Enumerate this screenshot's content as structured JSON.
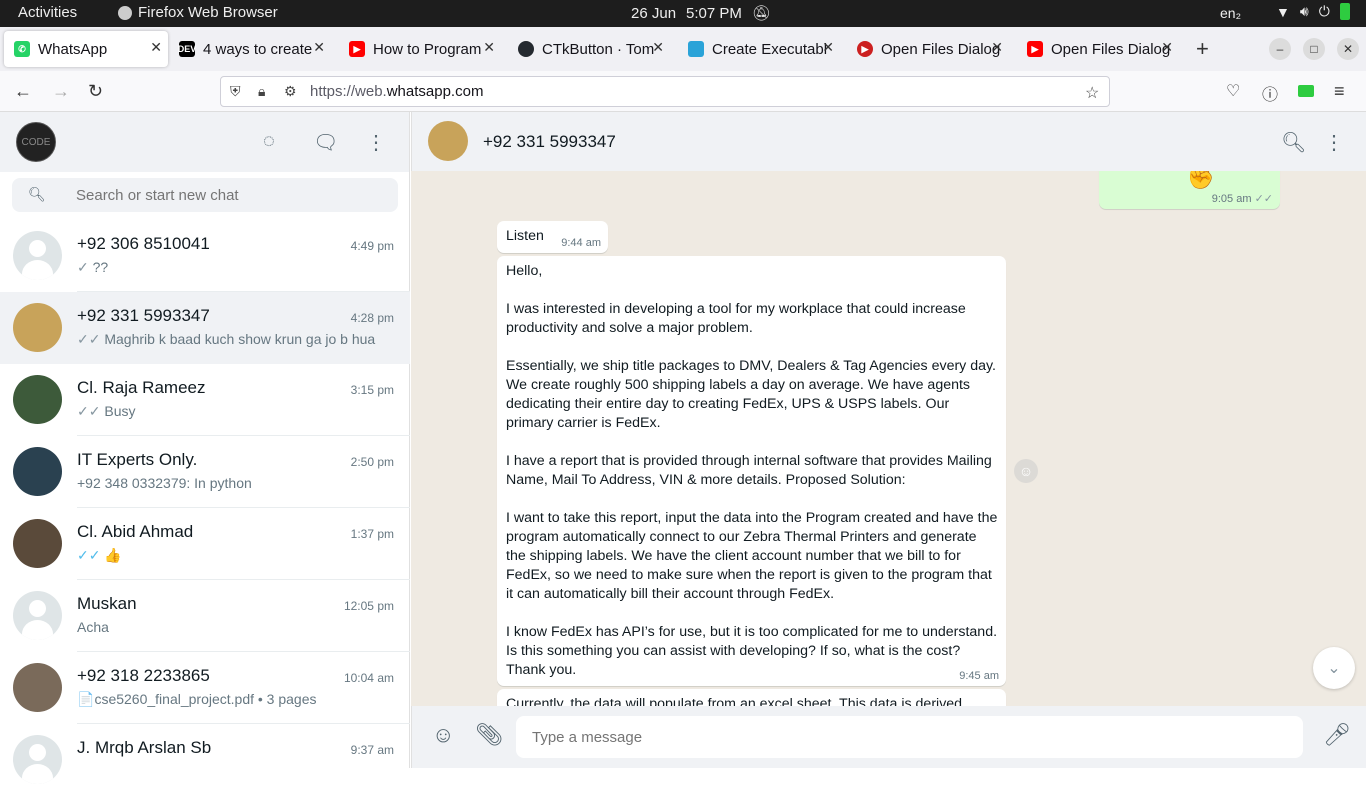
{
  "topbar": {
    "activities": "Activities",
    "app_name": "Firefox Web Browser",
    "date": "26 Jun",
    "time": "5:07 PM",
    "lang": "en₂"
  },
  "browser": {
    "tabs": [
      {
        "title": "WhatsApp",
        "fav": "#25d366",
        "icon": "whatsapp-icon"
      },
      {
        "title": "4 ways to create",
        "fav": "#000000",
        "icon": "dev-icon"
      },
      {
        "title": "How to Program",
        "fav": "#ff0000",
        "icon": "youtube-icon"
      },
      {
        "title": "CTkButton · Tom",
        "fav": "#24292f",
        "icon": "github-icon"
      },
      {
        "title": "Create Executabl",
        "fav": "#2aa3d8",
        "icon": "site-icon"
      },
      {
        "title": "Open Files Dialog",
        "fav": "#cc2020",
        "icon": "site-icon"
      },
      {
        "title": "Open Files Dialog",
        "fav": "#ff0000",
        "icon": "youtube-icon"
      }
    ],
    "url_prefix": "https://web.",
    "url_domain": "whatsapp.com"
  },
  "sidebar": {
    "my_avatar_text": "CODE",
    "search_placeholder": "Search or start new chat",
    "chats": [
      {
        "name": "+92 306 8510041",
        "time": "4:49 pm",
        "tick": "✓",
        "tick_color": "grey",
        "preview": "??",
        "avatar_color": "#dfe5e7",
        "default_avatar": true
      },
      {
        "name": "+92 331 5993347",
        "time": "4:28 pm",
        "tick": "✓✓",
        "tick_color": "grey",
        "preview": "Maghrib k baad kuch show krun ga jo b hua",
        "avatar_color": "#c8a35a",
        "default_avatar": false,
        "selected": true
      },
      {
        "name": "Cl. Raja Rameez",
        "time": "3:15 pm",
        "tick": "✓✓",
        "tick_color": "grey",
        "preview": "Busy",
        "avatar_color": "#3d5a3a",
        "default_avatar": false
      },
      {
        "name": "IT Experts Only.",
        "time": "2:50 pm",
        "tick": "",
        "tick_color": "grey",
        "preview": "+92 348 0332379: In python",
        "avatar_color": "#2a4150",
        "default_avatar": false
      },
      {
        "name": "Cl. Abid Ahmad",
        "time": "1:37 pm",
        "tick": "✓✓",
        "tick_color": "blue",
        "preview": "👍",
        "avatar_color": "#5a4a3a",
        "default_avatar": false
      },
      {
        "name": "Muskan",
        "time": "12:05 pm",
        "tick": "",
        "tick_color": "grey",
        "preview": "Acha",
        "avatar_color": "#dfe5e7",
        "default_avatar": true
      },
      {
        "name": "+92 318 2233865",
        "time": "10:04 am",
        "tick": "📄",
        "tick_color": "grey",
        "preview": "cse5260_final_project.pdf • 3 pages",
        "avatar_color": "#7a6a5a",
        "default_avatar": false
      },
      {
        "name": "J. Mrqb Arslan Sb",
        "time": "9:37 am",
        "tick": "",
        "tick_color": "grey",
        "preview": "",
        "avatar_color": "#dfe5e7",
        "default_avatar": true
      }
    ]
  },
  "conversation": {
    "contact_name": "+92 331 5993347",
    "out_msg_time": "9:05 am",
    "out_msg_ticks": "✓✓",
    "listen_text": "Listen",
    "listen_time": "9:44 am",
    "long_msg_paragraphs": [
      "Hello,",
      "I was interested in developing a tool for my workplace that could increase productivity and solve a major problem.",
      "Essentially, we ship title packages to DMV, Dealers & Tag Agencies every day. We create roughly 500 shipping labels a day on average. We have agents dedicating their entire day to creating FedEx, UPS & USPS labels. Our primary carrier is FedEx.",
      "I have a report that is provided through internal software that provides Mailing Name, Mail To Address, VIN & more details. Proposed Solution:",
      "I want to take this report, input the data into the Program created and have the program automatically connect to our Zebra Thermal Printers and generate the shipping labels. We have the client account number that we bill to for FedEx, so we need to make sure when the report is given to the program that it can automatically bill their account through FedEx.",
      "I know FedEx has API’s for use, but it is too complicated for me to understand. Is this something you can assist with developing? If so, what is the cost? Thank you."
    ],
    "long_msg_time": "9:45 am",
    "next_msg_text": "Currently, the data will populate from an excel sheet. This data is derived",
    "compose_placeholder": "Type a message"
  }
}
